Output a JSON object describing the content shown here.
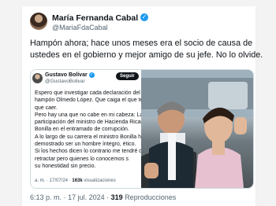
{
  "tweet": {
    "author_name": "María Fernanda Cabal",
    "author_handle": "@MariaFdaCabal",
    "text_lines": [
      "Hampón ahora; hace unos meses era el socio de causa de",
      "ustedes en el gobierno y mejor amigo de su jefe. No lo olvide."
    ],
    "time": "6:13 p. m.",
    "separator": "·",
    "date": "17 jul. 2024",
    "views_count": "319",
    "views_label": "Reproducciones"
  },
  "quoted": {
    "author_name": "Gustavo Bolívar",
    "author_handle": "@GustavoBolivar",
    "follow_label": "Seguir",
    "text_lines": [
      "Espero que investigar cada declaración del confes",
      "hampón Olmedo López. Que caiga el que tenga",
      "que caer.",
      "Pero hay una que no cabe en mi cabeza: La",
      "participación del ministro de Hacienda Ricardo",
      "Bonilla en el entramado de corrupción.",
      "A lo largo de su carrera el ministro Bonilla ha",
      "demostrado ser un hombre íntegro, ético.",
      "Si los hechos dicen lo contrario me tendré que",
      "retractar pero quienes lo conocemos s",
      "su honestidad sin precio."
    ],
    "meta_prefix": "a. m. · 17/07/24 ·",
    "views_count": "163k",
    "views_label": "visualizaciones"
  },
  "icons": {
    "verified": "verified-badge-icon"
  },
  "colors": {
    "accent": "#1d9bf0",
    "text": "#0f1419",
    "muted": "#536471",
    "border": "#cfd9de"
  }
}
